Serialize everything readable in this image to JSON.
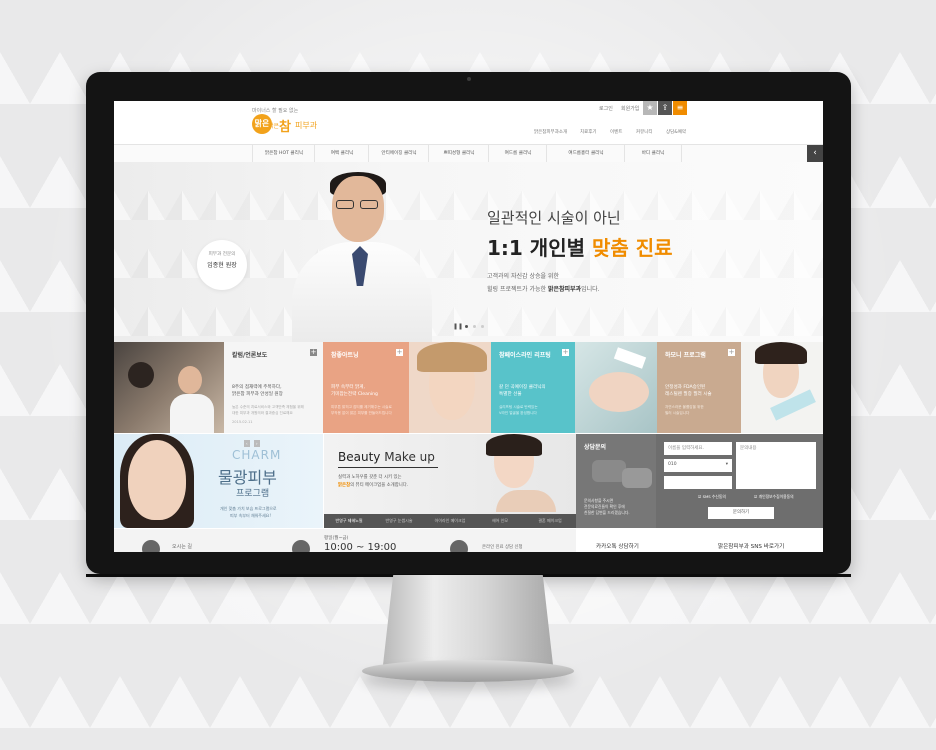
{
  "header": {
    "logo_tag": "마이너스 할 필요 없는",
    "logo_mark": "맑은",
    "logo_pre": "맑은",
    "logo_main": "참",
    "logo_sub": "피부과",
    "util_links": [
      "로그인",
      "회원가입"
    ],
    "gnb_top": [
      "맑은참피부과소개",
      "치료후기",
      "이벤트",
      "커뮤니티",
      "상담&예약"
    ]
  },
  "nav": {
    "items": [
      "맑은참 HOT 클리닉",
      "여백 클리닉",
      "안티에이징 클리닉",
      "쁘띠성형 클리닉",
      "여드름 클리닉",
      "여드름흉터 클리닉",
      "바디 클리닉"
    ]
  },
  "hero": {
    "doctor_title": "피부과 전문의",
    "doctor_name": "임종현 원장",
    "line1": "일관적인 시술이 아닌",
    "line2_pre": "1:1 개인별 ",
    "line2_hl": "맞춤 진료",
    "sub1": "고객과의 자신감 상승을 위한",
    "sub2_pre": "힐링 프로젝트가 가능한 ",
    "sub2_b": "맑은참피부과",
    "sub2_post": "입니다."
  },
  "row1": {
    "column": {
      "title": "칼럼/언론보도",
      "lines": [
        "8주의 점재력에 주목하다,",
        "맑은참 피부과 안성일 원장"
      ],
      "small": [
        "높은 수준의 치료서비스와 고객만족 체험을 위해",
        "대한 피부과 개원의와 결과중심 진료해요"
      ],
      "date": "2015.02.11"
    },
    "cleaning": {
      "title": "참좋아트닝",
      "lines": [
        "피부 속부터 맑게,",
        "기미잡는전략 Cleaning"
      ],
      "small": [
        "피부톤 밝히고 잡티를 제거해주는 시술로",
        "부작용 없이 맑은 피부를 만들어드립니다"
      ]
    },
    "lifting": {
      "title": "참페이스라인 리프팅",
      "lines": [
        "갈 던 곡예이징 클리닉의",
        "특별한 선물"
      ],
      "small": [
        "실리프팅 시술로 탄력있는",
        "V라인 얼굴을 완성합니다"
      ]
    },
    "harmony": {
      "title": "하모니 프로그램",
      "lines": [
        "안정성과 FDA승인된",
        "레스틸렌 필증 필러 시술"
      ],
      "small": [
        "자연스러운 볼륨감을 위한",
        "필러 시술입니다"
      ]
    }
  },
  "row2": {
    "charm": {
      "en": "CHARM",
      "ko": "물광피부",
      "sub": "프로그램",
      "desc1": "개인 맞춤 가치 보습 프로그램으로",
      "desc2": "피부 속부터 채워주세요!"
    },
    "beauty": {
      "title": "Beauty",
      "title2": "Make up",
      "desc1": "실력과 노하우를 갖춘 더 시키 있는",
      "desc2_b": "맑은참",
      "desc2": "의 뷰티 메이크업을 소개합니다.",
      "tabs": [
        "반영구 제헤노필",
        "반영구 눈썹시술",
        "아이라인 메이크업",
        "헤어 인모",
        "결혼 메이크업"
      ]
    },
    "consult": {
      "title": "상담문의",
      "name_placeholder": "이름을 입력하세요.",
      "phone_prefix": "010",
      "content_placeholder": "문의내용",
      "desc1": "문의사항을 주시면",
      "desc2": "전문의료진들이 확인 후에",
      "desc3": "친절한 답변을 드리겠습니다.",
      "sms_agree": "SMS 수신동의",
      "privacy_agree": "개인정보수집이용동의",
      "submit": "문의하기"
    }
  },
  "row3": {
    "location": "오시는 길",
    "hours_label": "평일(월~금)",
    "hours": "10:00 ~ 19:00",
    "online": "온라인 진료 상담 신청",
    "kakao": "카카오톡 상담하기",
    "sns": "맑은참피부과 SNS 바로가기"
  },
  "colors": {
    "accent": "#f08c00",
    "salmon": "#e9a384",
    "teal": "#58c3ca",
    "tan": "#c9aa90",
    "dark": "#444444"
  }
}
